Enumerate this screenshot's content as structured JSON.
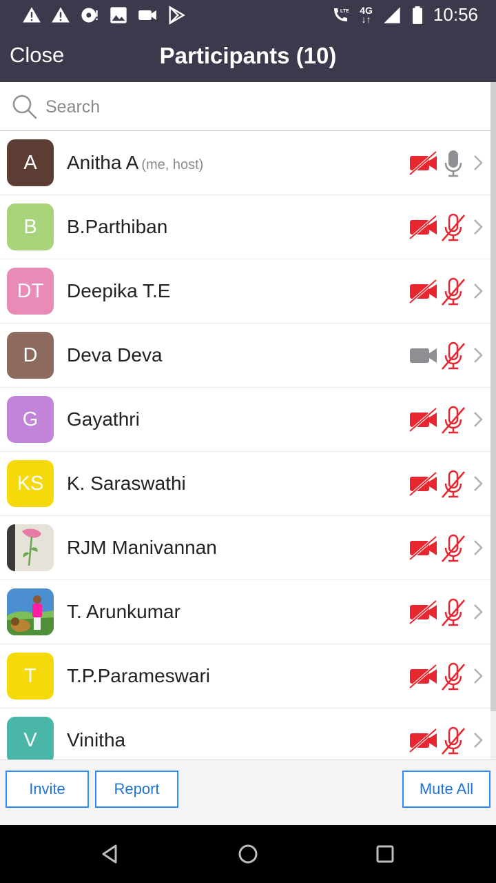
{
  "status_bar": {
    "time": "10:56",
    "network_top": "4G",
    "network_bottom": "↓↑",
    "lte_label": "LTE",
    "icons": [
      "warning-icon",
      "warning-icon",
      "alert-disc-icon",
      "image-icon",
      "video-icon",
      "play-store-icon",
      "lte-call-icon",
      "signal-icon",
      "battery-icon"
    ]
  },
  "header": {
    "close_label": "Close",
    "title": "Participants (10)"
  },
  "search": {
    "placeholder": "Search",
    "value": ""
  },
  "colors": {
    "header_bg": "#3a3a4c",
    "muted_red": "#e8262f",
    "active_gray": "#8e8e93",
    "button_blue": "#2d8cff"
  },
  "participants": [
    {
      "initials": "A",
      "name": "Anitha A",
      "tag": "(me, host)",
      "avatar_color": "#5c3d34",
      "video": "off",
      "audio": "on"
    },
    {
      "initials": "B",
      "name": "B.Parthiban",
      "tag": "",
      "avatar_color": "#a9d37b",
      "video": "off",
      "audio": "muted"
    },
    {
      "initials": "DT",
      "name": "Deepika T.E",
      "tag": "",
      "avatar_color": "#e88bb6",
      "video": "off",
      "audio": "muted"
    },
    {
      "initials": "D",
      "name": "Deva Deva",
      "tag": "",
      "avatar_color": "#8c6a5e",
      "video": "on",
      "audio": "muted"
    },
    {
      "initials": "G",
      "name": "Gayathri",
      "tag": "",
      "avatar_color": "#c184d9",
      "video": "off",
      "audio": "muted"
    },
    {
      "initials": "KS",
      "name": "K. Saraswathi",
      "tag": "",
      "avatar_color": "#f5d90b",
      "video": "off",
      "audio": "muted"
    },
    {
      "initials": "",
      "name": "RJM Manivannan",
      "tag": "",
      "avatar_color": "#d9d6cf",
      "avatar_image": "flower-drawing",
      "video": "off",
      "audio": "muted"
    },
    {
      "initials": "",
      "name": "T. Arunkumar",
      "tag": "",
      "avatar_color": "#4c8fd0",
      "avatar_image": "person-photo",
      "video": "off",
      "audio": "muted"
    },
    {
      "initials": "T",
      "name": "T.P.Parameswari",
      "tag": "",
      "avatar_color": "#f5d90b",
      "video": "off",
      "audio": "muted"
    },
    {
      "initials": "V",
      "name": "Vinitha",
      "tag": "",
      "avatar_color": "#4ab6a8",
      "video": "off",
      "audio": "muted"
    }
  ],
  "actions": {
    "invite_label": "Invite",
    "report_label": "Report",
    "mute_all_label": "Mute All"
  },
  "nav": {
    "icons": [
      "back-icon",
      "home-icon",
      "recents-icon"
    ]
  }
}
